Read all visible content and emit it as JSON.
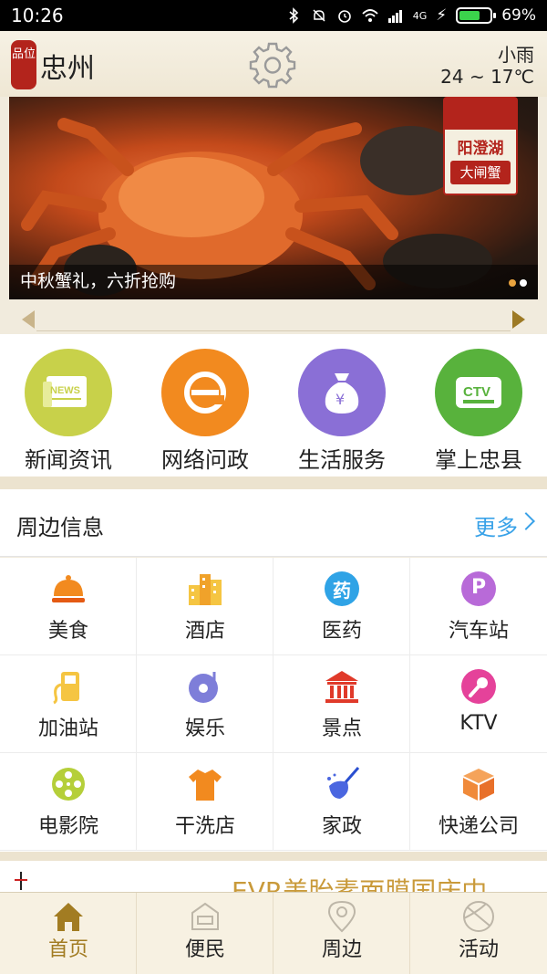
{
  "status_bar": {
    "time": "10:26",
    "network": "4G",
    "battery": "69%"
  },
  "header": {
    "seal_text": "品位",
    "city": "忠州",
    "weather": {
      "desc": "小雨",
      "temp": "24 ~ 17℃"
    }
  },
  "banner": {
    "caption": "中秋蟹礼，六折抢购",
    "brand_line1": "阳澄湖",
    "brand_line2": "大闸蟹"
  },
  "main_features": [
    {
      "label": "新闻资讯",
      "icon": "news-icon",
      "color": "#c8d14a"
    },
    {
      "label": "网络问政",
      "icon": "ie-icon",
      "color": "#f28a1f"
    },
    {
      "label": "生活服务",
      "icon": "money-bag-icon",
      "color": "#8a6fd6"
    },
    {
      "label": "掌上忠县",
      "icon": "tv-icon",
      "color": "#58b23c"
    }
  ],
  "nearby": {
    "title": "周边信息",
    "more": "更多",
    "items": [
      {
        "label": "美食",
        "icon": "food-cloche-icon"
      },
      {
        "label": "酒店",
        "icon": "hotel-icon"
      },
      {
        "label": "医药",
        "icon": "pharmacy-icon",
        "icon_text": "药"
      },
      {
        "label": "汽车站",
        "icon": "parking-icon",
        "icon_text": "P"
      },
      {
        "label": "加油站",
        "icon": "gas-station-icon"
      },
      {
        "label": "娱乐",
        "icon": "music-disc-icon"
      },
      {
        "label": "景点",
        "icon": "temple-icon"
      },
      {
        "label": "KTV",
        "icon": "microphone-icon"
      },
      {
        "label": "电影院",
        "icon": "film-reel-icon"
      },
      {
        "label": "干洗店",
        "icon": "tshirt-icon"
      },
      {
        "label": "家政",
        "icon": "cleaning-icon"
      },
      {
        "label": "快递公司",
        "icon": "package-icon"
      }
    ]
  },
  "ad_strip": {
    "text": "EVR美胎素面膜国庆中"
  },
  "bottom_nav": [
    {
      "label": "首页",
      "icon": "home-icon",
      "active": true
    },
    {
      "label": "便民",
      "icon": "service-icon",
      "active": false
    },
    {
      "label": "周边",
      "icon": "location-icon",
      "active": false
    },
    {
      "label": "活动",
      "icon": "ball-icon",
      "active": false
    }
  ]
}
